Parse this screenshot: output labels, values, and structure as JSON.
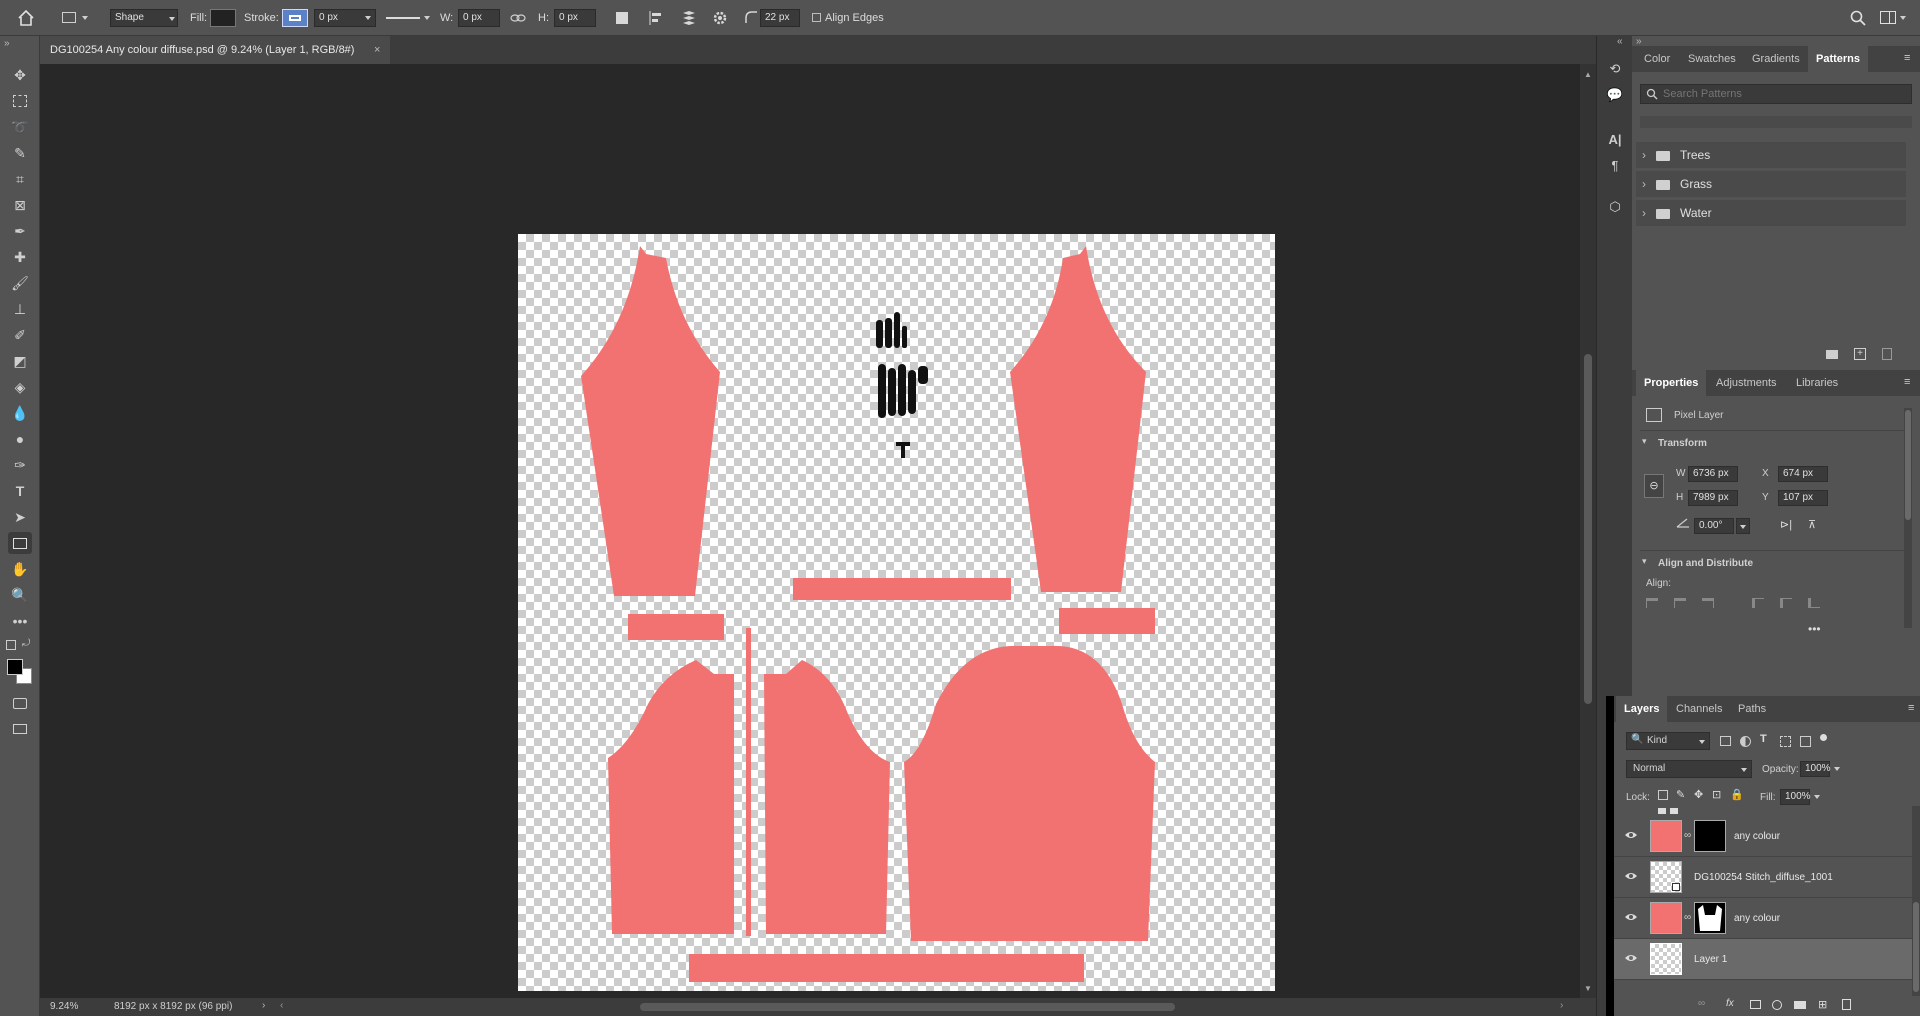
{
  "options_bar": {
    "home_icon": "home-icon",
    "shape_mode": "Shape",
    "fill_label": "Fill:",
    "stroke_label": "Stroke:",
    "stroke_width": "0 px",
    "w_label": "W:",
    "w_value": "0 px",
    "h_label": "H:",
    "h_value": "0 px",
    "radius_value": "22 px",
    "align_edges_label": "Align Edges"
  },
  "document": {
    "tab_title": "DG100254 Any colour diffuse.psd @ 9.24% (Layer 1, RGB/8#)",
    "zoom": "9.24%",
    "doc_info": "8192 px x 8192 px (96 ppi)"
  },
  "colors": {
    "pattern_fill": "#f27272",
    "ui_bg": "#535353",
    "canvas_bg": "#282828"
  },
  "patterns_panel": {
    "tabs": [
      "Color",
      "Swatches",
      "Gradients",
      "Patterns"
    ],
    "active_tab": "Patterns",
    "search_placeholder": "Search Patterns",
    "folders": [
      "Trees",
      "Grass",
      "Water"
    ]
  },
  "properties_panel": {
    "tabs": [
      "Properties",
      "Adjustments",
      "Libraries"
    ],
    "active_tab": "Properties",
    "layer_kind": "Pixel Layer",
    "transform_title": "Transform",
    "w_label": "W",
    "w_value": "6736 px",
    "x_label": "X",
    "x_value": "674 px",
    "h_label": "H",
    "h_value": "7989 px",
    "y_label": "Y",
    "y_value": "107 px",
    "angle_value": "0.00°",
    "align_title": "Align and Distribute",
    "align_label": "Align:"
  },
  "layers_panel": {
    "tabs": [
      "Layers",
      "Channels",
      "Paths"
    ],
    "active_tab": "Layers",
    "filter_kind": "Kind",
    "blend_mode": "Normal",
    "opacity_label": "Opacity:",
    "opacity_value": "100%",
    "lock_label": "Lock:",
    "fill_label": "Fill:",
    "fill_value": "100%",
    "layers": [
      {
        "name": "any colour",
        "type": "fill-with-mask-black"
      },
      {
        "name": "DG100254 Stitch_diffuse_1001",
        "type": "smart"
      },
      {
        "name": "any colour",
        "type": "fill-with-mask-shape"
      },
      {
        "name": "Layer 1",
        "type": "pixel",
        "selected": true
      }
    ]
  }
}
